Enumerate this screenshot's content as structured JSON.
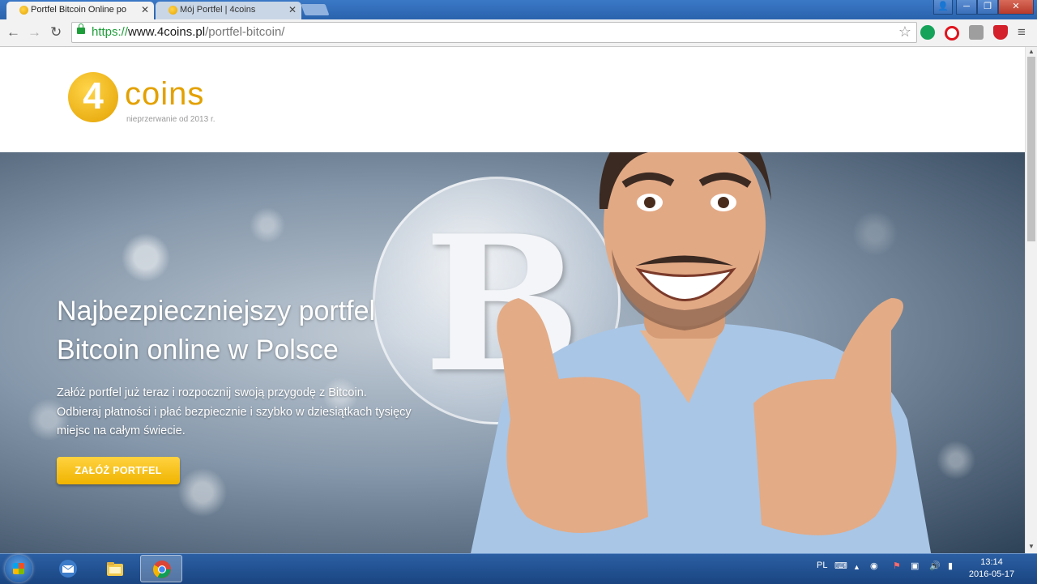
{
  "browser": {
    "tabs": [
      {
        "title": "Portfel Bitcoin Online po",
        "active": true
      },
      {
        "title": "Mój Portfel | 4coins",
        "active": false
      }
    ],
    "tab_close": "✕",
    "window_controls": {
      "user": "👤",
      "minimize": "─",
      "maximize": "❐",
      "close": "✕"
    },
    "nav": {
      "back": "←",
      "forward": "→",
      "reload": "↻",
      "menu": "≡"
    },
    "url": {
      "scheme": "https://",
      "host": "www.4coins.pl",
      "path": "/portfel-bitcoin/"
    },
    "star": "☆",
    "extensions": [
      {
        "name": "grammarly-icon",
        "color": "#15a35a"
      },
      {
        "name": "opera-icon",
        "color": "#e0141e"
      },
      {
        "name": "extension-grey-icon",
        "color": "#9e9e9e"
      },
      {
        "name": "shield-red-icon",
        "color": "#d3202a"
      }
    ]
  },
  "page": {
    "logo": {
      "digit": "4",
      "word": "coins",
      "tagline": "nieprzerwanie od 2013 r."
    },
    "hero": {
      "title_line1": "Najbezpieczniejszy portfel",
      "title_line2": "Bitcoin online w Polsce",
      "text": "Załóż portfel już teraz i rozpocznij swoją przygodę z Bitcoin. Odbieraj płatności i płać bezpiecznie i szybko w dziesiątkach tysięcy miejsc na całym świecie.",
      "cta": "ZAŁÓŻ PORTFEL",
      "coin_symbol": "B"
    },
    "accent": "#f0b400"
  },
  "taskbar": {
    "apps": [
      {
        "name": "outlook-icon",
        "active": false
      },
      {
        "name": "file-explorer-icon",
        "active": false
      },
      {
        "name": "chrome-icon",
        "active": true
      }
    ],
    "language": "PL",
    "time": "13:14",
    "date": "2016-05-17"
  }
}
